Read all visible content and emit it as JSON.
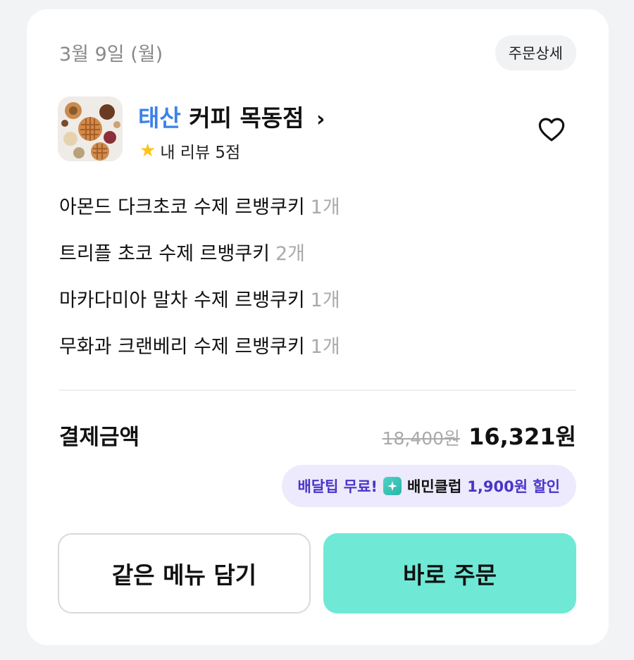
{
  "order": {
    "date": "3월 9일 (월)",
    "detail_label": "주문상세"
  },
  "store": {
    "brand": "태산",
    "name": "커피 목동점",
    "chevron": "›",
    "review_label": "내 리뷰 5점",
    "favorite_icon": "heart-outline-icon"
  },
  "items": [
    {
      "name": "아몬드 다크초코 수제 르뱅쿠키",
      "qty": "1개"
    },
    {
      "name": "트리플 초코 수제 르뱅쿠키",
      "qty": "2개"
    },
    {
      "name": "마카다미아 말차 수제 르뱅쿠키",
      "qty": "1개"
    },
    {
      "name": "무화과 크랜베리 수제 르뱅쿠키",
      "qty": "1개"
    }
  ],
  "payment": {
    "label": "결제금액",
    "original_price": "18,400원",
    "final_price": "16,321원"
  },
  "promo": {
    "free_delivery": "배달팁 무료!",
    "club": "배민클럽",
    "discount": "1,900원 할인",
    "accent_color": "#4a35c7",
    "background": "#eceafc"
  },
  "actions": {
    "same_menu": "같은 메뉴 담기",
    "order_now": "바로 주문",
    "order_color": "#6fe9d6"
  }
}
